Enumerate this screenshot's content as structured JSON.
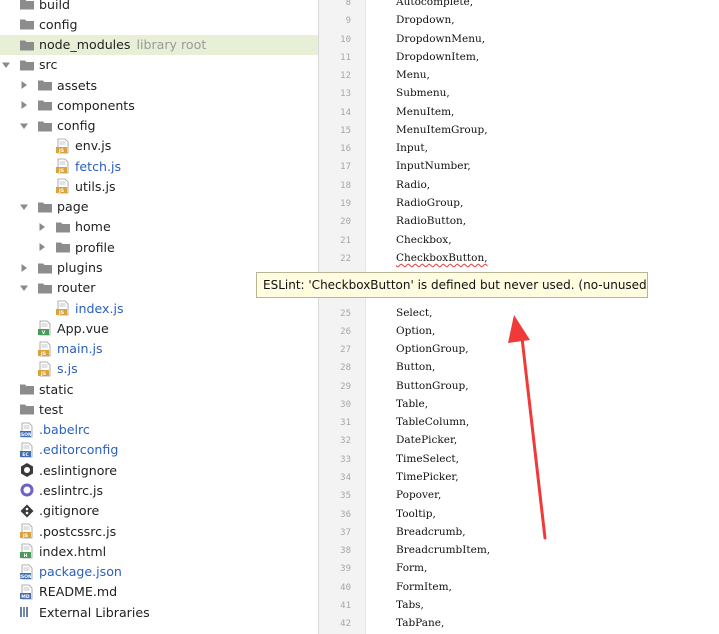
{
  "project_tree": {
    "items": [
      {
        "label": "build",
        "icon": "folder-icon",
        "indent": 0,
        "expandable": false,
        "expanded": false,
        "label_style": "normal"
      },
      {
        "label": "config",
        "icon": "folder-icon",
        "indent": 0,
        "expandable": false,
        "expanded": false,
        "label_style": "normal"
      },
      {
        "label": "node_modules",
        "extra": "library root",
        "icon": "folder-icon",
        "indent": 0,
        "expandable": false,
        "expanded": false,
        "label_style": "normal",
        "selected": true
      },
      {
        "label": "src",
        "icon": "folder-icon",
        "indent": 0,
        "expandable": true,
        "expanded": true,
        "label_style": "normal"
      },
      {
        "label": "assets",
        "icon": "folder-icon",
        "indent": 1,
        "expandable": true,
        "expanded": false,
        "label_style": "normal"
      },
      {
        "label": "components",
        "icon": "folder-icon",
        "indent": 1,
        "expandable": true,
        "expanded": false,
        "label_style": "normal"
      },
      {
        "label": "config",
        "icon": "folder-icon",
        "indent": 1,
        "expandable": true,
        "expanded": true,
        "label_style": "normal"
      },
      {
        "label": "env.js",
        "icon": "js-file-icon",
        "indent": 2,
        "expandable": false,
        "expanded": false,
        "label_style": "normal"
      },
      {
        "label": "fetch.js",
        "icon": "js-file-icon",
        "indent": 2,
        "expandable": false,
        "expanded": false,
        "label_style": "blue"
      },
      {
        "label": "utils.js",
        "icon": "js-file-icon",
        "indent": 2,
        "expandable": false,
        "expanded": false,
        "label_style": "normal"
      },
      {
        "label": "page",
        "icon": "folder-icon",
        "indent": 1,
        "expandable": true,
        "expanded": true,
        "label_style": "normal"
      },
      {
        "label": "home",
        "icon": "folder-icon",
        "indent": 2,
        "expandable": true,
        "expanded": false,
        "label_style": "normal"
      },
      {
        "label": "profile",
        "icon": "folder-icon",
        "indent": 2,
        "expandable": true,
        "expanded": false,
        "label_style": "normal"
      },
      {
        "label": "plugins",
        "icon": "folder-icon",
        "indent": 1,
        "expandable": true,
        "expanded": false,
        "label_style": "normal"
      },
      {
        "label": "router",
        "icon": "folder-icon",
        "indent": 1,
        "expandable": true,
        "expanded": true,
        "label_style": "normal"
      },
      {
        "label": "index.js",
        "icon": "js-file-icon",
        "indent": 2,
        "expandable": false,
        "expanded": false,
        "label_style": "blue"
      },
      {
        "label": "App.vue",
        "icon": "vue-file-icon",
        "indent": 1,
        "expandable": false,
        "expanded": false,
        "label_style": "normal"
      },
      {
        "label": "main.js",
        "icon": "js-file-icon",
        "indent": 1,
        "expandable": false,
        "expanded": false,
        "label_style": "blue"
      },
      {
        "label": "s.js",
        "icon": "js-file-icon",
        "indent": 1,
        "expandable": false,
        "expanded": false,
        "label_style": "blue"
      },
      {
        "label": "static",
        "icon": "folder-icon",
        "indent": 0,
        "expandable": false,
        "expanded": false,
        "label_style": "normal"
      },
      {
        "label": "test",
        "icon": "folder-icon",
        "indent": 0,
        "expandable": false,
        "expanded": false,
        "label_style": "normal"
      },
      {
        "label": ".babelrc",
        "icon": "json-file-icon",
        "indent": 0,
        "expandable": false,
        "expanded": false,
        "label_style": "blue"
      },
      {
        "label": ".editorconfig",
        "icon": "config-file-icon",
        "indent": 0,
        "expandable": false,
        "expanded": false,
        "label_style": "blue"
      },
      {
        "label": ".eslintignore",
        "icon": "eslintignore-file-icon",
        "indent": 0,
        "expandable": false,
        "expanded": false,
        "label_style": "normal"
      },
      {
        "label": ".eslintrc.js",
        "icon": "eslintrc-file-icon",
        "indent": 0,
        "expandable": false,
        "expanded": false,
        "label_style": "normal"
      },
      {
        "label": ".gitignore",
        "icon": "git-file-icon",
        "indent": 0,
        "expandable": false,
        "expanded": false,
        "label_style": "normal"
      },
      {
        "label": ".postcssrc.js",
        "icon": "js-file-icon",
        "indent": 0,
        "expandable": false,
        "expanded": false,
        "label_style": "normal"
      },
      {
        "label": "index.html",
        "icon": "html-file-icon",
        "indent": 0,
        "expandable": false,
        "expanded": false,
        "label_style": "normal"
      },
      {
        "label": "package.json",
        "icon": "json-file-icon",
        "indent": 0,
        "expandable": false,
        "expanded": false,
        "label_style": "blue"
      },
      {
        "label": "README.md",
        "icon": "md-file-icon",
        "indent": 0,
        "expandable": false,
        "expanded": false,
        "label_style": "normal"
      },
      {
        "label": "External Libraries",
        "icon": "external-libraries-icon",
        "indent": 0,
        "expandable": false,
        "expanded": false,
        "label_style": "normal"
      }
    ]
  },
  "editor": {
    "lines": [
      {
        "number": "8",
        "code": "Autocomplete,"
      },
      {
        "number": "9",
        "code": "Dropdown,"
      },
      {
        "number": "10",
        "code": "DropdownMenu,"
      },
      {
        "number": "11",
        "code": "DropdownItem,"
      },
      {
        "number": "12",
        "code": "Menu,"
      },
      {
        "number": "13",
        "code": "Submenu,"
      },
      {
        "number": "14",
        "code": "MenuItem,"
      },
      {
        "number": "15",
        "code": "MenuItemGroup,"
      },
      {
        "number": "16",
        "code": "Input,"
      },
      {
        "number": "17",
        "code": "InputNumber,"
      },
      {
        "number": "18",
        "code": "Radio,"
      },
      {
        "number": "19",
        "code": "RadioGroup,"
      },
      {
        "number": "20",
        "code": "RadioButton,"
      },
      {
        "number": "21",
        "code": "Checkbox,"
      },
      {
        "number": "22",
        "code": "CheckboxButton,",
        "warning": true
      },
      {
        "number": "",
        "code": ""
      },
      {
        "number": "",
        "code": ""
      },
      {
        "number": "25",
        "code": "Select,"
      },
      {
        "number": "26",
        "code": "Option,"
      },
      {
        "number": "27",
        "code": "OptionGroup,"
      },
      {
        "number": "28",
        "code": "Button,"
      },
      {
        "number": "29",
        "code": "ButtonGroup,"
      },
      {
        "number": "30",
        "code": "Table,"
      },
      {
        "number": "31",
        "code": "TableColumn,"
      },
      {
        "number": "32",
        "code": "DatePicker,"
      },
      {
        "number": "33",
        "code": "TimeSelect,"
      },
      {
        "number": "34",
        "code": "TimePicker,"
      },
      {
        "number": "35",
        "code": "Popover,"
      },
      {
        "number": "36",
        "code": "Tooltip,"
      },
      {
        "number": "37",
        "code": "Breadcrumb,"
      },
      {
        "number": "38",
        "code": "BreadcrumbItem,"
      },
      {
        "number": "39",
        "code": "Form,"
      },
      {
        "number": "40",
        "code": "FormItem,"
      },
      {
        "number": "41",
        "code": "Tabs,"
      },
      {
        "number": "42",
        "code": "TabPane,"
      }
    ]
  },
  "tooltip": {
    "text": "ESLint: 'CheckboxButton' is defined but never used. (no-unused-vars)"
  },
  "colors": {
    "folder": "#8c8c8c",
    "js_badge": "#d8a23c",
    "json_badge": "#3f6db3",
    "selection": "#e7f0d6",
    "tooltip_bg": "#fffce0",
    "annotation_arrow": "#f03a3a",
    "warning_squiggle": "#e24a4a"
  }
}
